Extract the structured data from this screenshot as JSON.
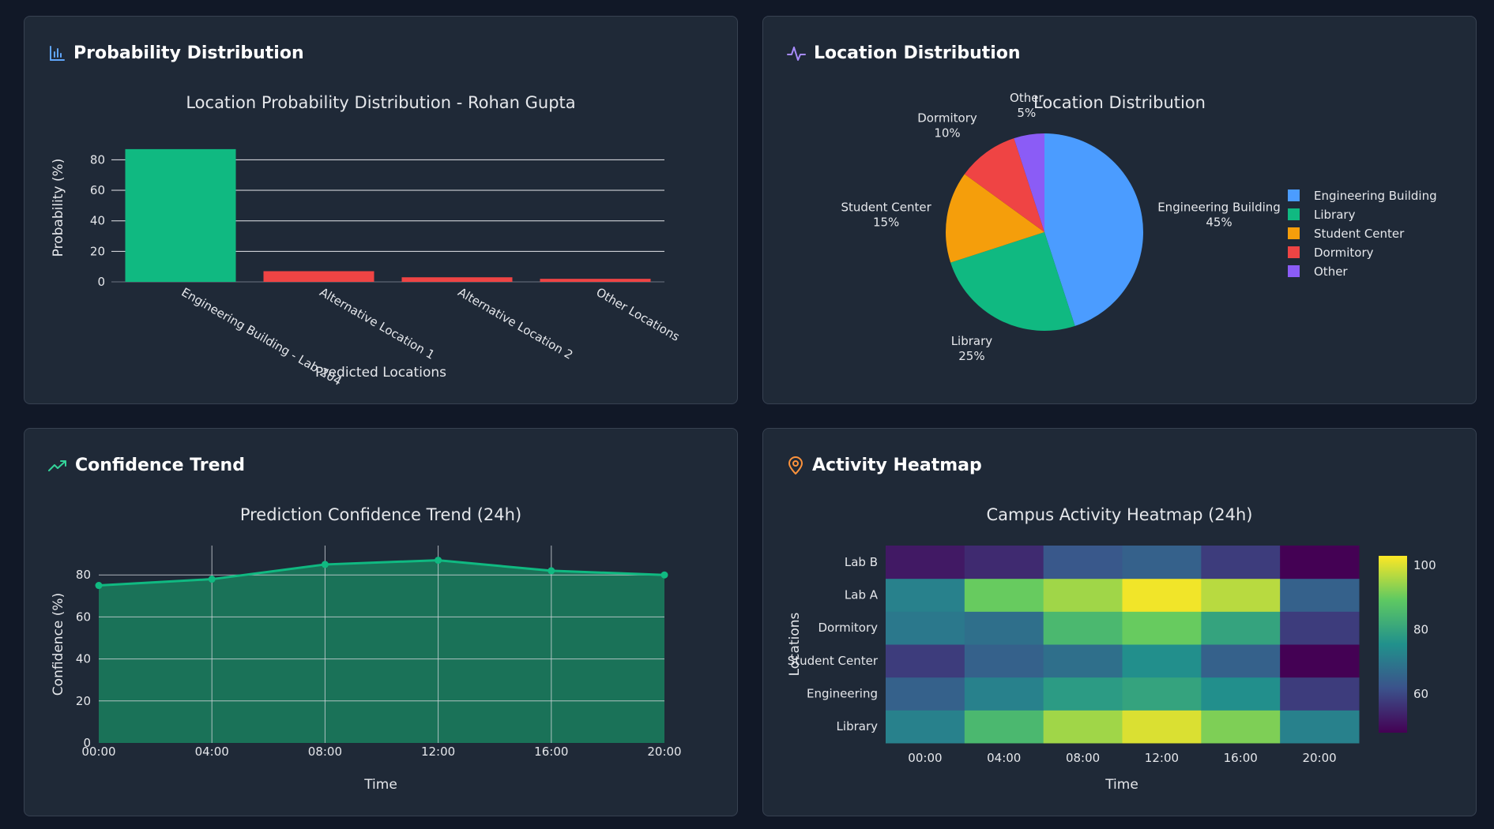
{
  "panels": {
    "probability": {
      "header": "Probability Distribution",
      "icon": "bar-chart-icon",
      "icon_color": "#60a5fa"
    },
    "location": {
      "header": "Location Distribution",
      "icon": "activity-pulse-icon",
      "icon_color": "#a78bfa"
    },
    "confidence": {
      "header": "Confidence Trend",
      "icon": "trending-up-icon",
      "icon_color": "#34d399"
    },
    "activity": {
      "header": "Activity Heatmap",
      "icon": "map-pin-icon",
      "icon_color": "#fb923c"
    }
  },
  "colors": {
    "page_background": "#111827",
    "card_background": "#1f2937",
    "text": "#f3f4f6",
    "green": "#10b981",
    "red": "#ef4444"
  },
  "chart_data": [
    {
      "id": "probability",
      "type": "bar",
      "title": "Location Probability Distribution - Rohan Gupta",
      "xlabel": "Predicted Locations",
      "ylabel": "Probability (%)",
      "categories": [
        "Engineering Building - Lab 204",
        "Alternative Location 1",
        "Alternative Location 2",
        "Other Locations"
      ],
      "values": [
        87,
        7,
        3,
        2
      ],
      "bar_colors": [
        "#10b981",
        "#ef4444",
        "#ef4444",
        "#ef4444"
      ],
      "yticks": [
        0,
        20,
        40,
        60,
        80
      ],
      "ylim": [
        0,
        91.6
      ],
      "grid": true
    },
    {
      "id": "location",
      "type": "pie",
      "title": "Location Distribution",
      "labels": [
        "Engineering Building",
        "Library",
        "Student Center",
        "Dormitory",
        "Other"
      ],
      "values": [
        45,
        25,
        15,
        10,
        5
      ],
      "colors": [
        "#4b9cff",
        "#10b981",
        "#f59e0b",
        "#ef4444",
        "#8b5cf6"
      ],
      "legend": "right"
    },
    {
      "id": "confidence",
      "type": "area",
      "title": "Prediction Confidence Trend (24h)",
      "xlabel": "Time",
      "ylabel": "Confidence (%)",
      "x": [
        "00:00",
        "04:00",
        "08:00",
        "12:00",
        "16:00",
        "20:00"
      ],
      "values": [
        75,
        78,
        85,
        87,
        82,
        80
      ],
      "yticks": [
        0,
        20,
        40,
        60,
        80
      ],
      "ylim": [
        0,
        94
      ],
      "line_color": "#10b981",
      "fill_color": "#1a7258",
      "grid": true
    },
    {
      "id": "activity",
      "type": "heatmap",
      "title": "Campus Activity Heatmap (24h)",
      "xlabel": "Time",
      "ylabel": "Locations",
      "x": [
        "00:00",
        "04:00",
        "08:00",
        "12:00",
        "16:00",
        "20:00"
      ],
      "y": [
        "Library",
        "Engineering",
        "Student Center",
        "Dormitory",
        "Lab A",
        "Lab B"
      ],
      "values": [
        [
          72,
          85,
          95,
          100,
          92,
          72
        ],
        [
          65,
          72,
          78,
          80,
          75,
          58
        ],
        [
          58,
          65,
          68,
          75,
          65,
          48
        ],
        [
          70,
          68,
          85,
          90,
          80,
          58
        ],
        [
          72,
          90,
          95,
          102,
          97,
          65
        ],
        [
          52,
          55,
          63,
          65,
          58,
          48
        ]
      ],
      "zlim": [
        48,
        103
      ],
      "colorbar_ticks": [
        60,
        80,
        100
      ]
    }
  ]
}
